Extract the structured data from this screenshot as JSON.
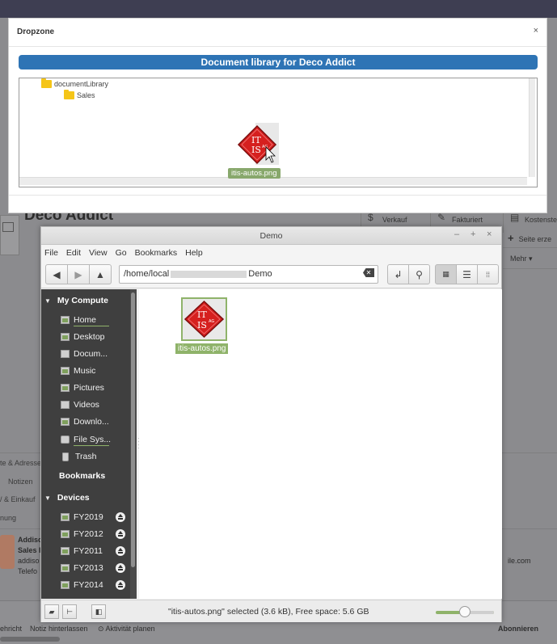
{
  "background_page": {
    "title": "Deco Addict",
    "stat_buttons": [
      {
        "icon": "$",
        "label": "Verkauf"
      },
      {
        "icon": "✎",
        "label": "Fakturiert"
      },
      {
        "icon": "▤",
        "label": "Kostenste"
      }
    ],
    "right_actions": [
      {
        "icon": "+",
        "label": "Seite erze"
      },
      {
        "label": "Mehr ▾"
      }
    ],
    "left_tabs": [
      "te & Adresse",
      "Notizen",
      "/ & Einkauf",
      "nung"
    ],
    "contact": {
      "name": "Addiso",
      "role": "Sales F",
      "email": "addiso",
      "phone": "Telefo",
      "email_right": "ile.com"
    },
    "chatter": {
      "send": "ehricht",
      "note": "Notiz hinterlassen",
      "activity": "Aktivität planen",
      "follow": "Abonnieren"
    }
  },
  "dropzone": {
    "title": "Dropzone",
    "close_label": "×",
    "library_title": "Document library for Deco Addict",
    "tree": [
      {
        "label": "documentLibrary",
        "level": 0
      },
      {
        "label": "Sales",
        "level": 1
      }
    ],
    "drag_label": "itis-autos.png"
  },
  "file_manager": {
    "window_title": "Demo",
    "window_buttons": {
      "minimize": "–",
      "maximize": "+",
      "close": "×"
    },
    "menu": [
      "File",
      "Edit",
      "View",
      "Go",
      "Bookmarks",
      "Help"
    ],
    "path_start": "/home/local",
    "path_end": "Demo",
    "sidebar": {
      "my_computer_header": "My Compute",
      "my_computer": [
        {
          "label": "Home",
          "icon": "home-icon"
        },
        {
          "label": "Desktop",
          "icon": "desktop-icon"
        },
        {
          "label": "Docum...",
          "icon": "documents-icon"
        },
        {
          "label": "Music",
          "icon": "music-icon"
        },
        {
          "label": "Pictures",
          "icon": "pictures-icon"
        },
        {
          "label": "Videos",
          "icon": "videos-icon"
        },
        {
          "label": "Downlo...",
          "icon": "downloads-icon"
        },
        {
          "label": "File Sys...",
          "icon": "filesystem-icon"
        },
        {
          "label": "Trash",
          "icon": "trash-icon"
        }
      ],
      "bookmarks_header": "Bookmarks",
      "devices_header": "Devices",
      "devices": [
        "FY2019",
        "FY2012",
        "FY2011",
        "FY2013",
        "FY2014"
      ]
    },
    "file": {
      "name": "itis-autos.png"
    },
    "status": "\"itis-autos.png\" selected (3.6 kB), Free space: 5.6 GB",
    "zoom_level": 0.55
  },
  "colors": {
    "accent_blue": "#2e74b5",
    "selection_green": "#8fb36a",
    "sidebar_bg": "#3f3f3f",
    "logo_red": "#d6201f"
  }
}
